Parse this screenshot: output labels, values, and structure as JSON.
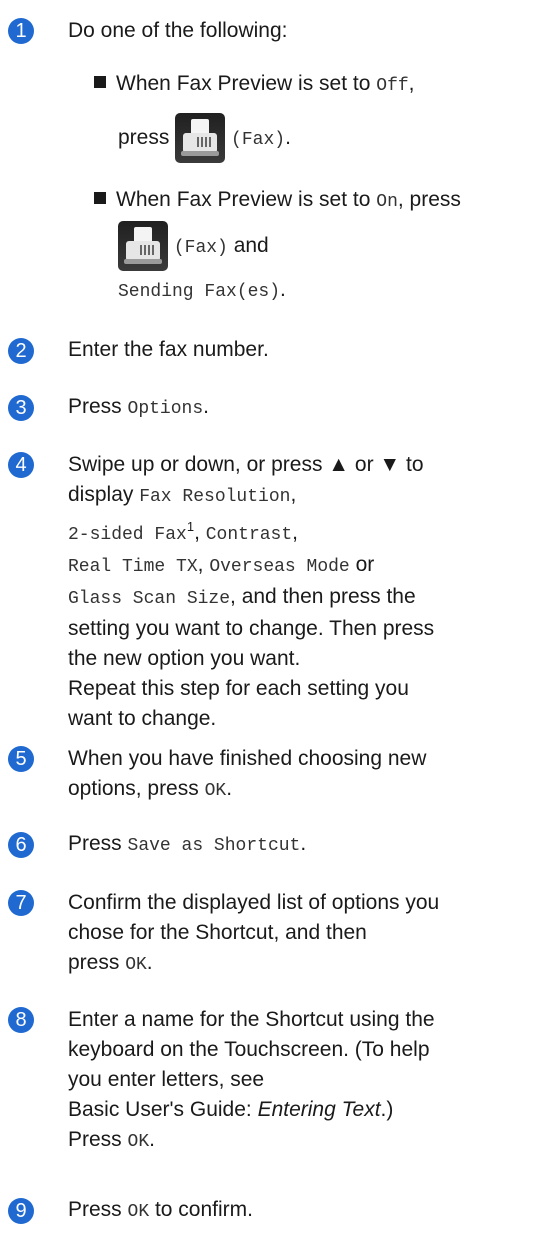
{
  "steps": [
    {
      "number": "1",
      "text": "Do one of the following:"
    },
    {
      "number": "2",
      "text": "Enter the fax number."
    },
    {
      "number": "3",
      "prefix": "Press ",
      "code": "Options",
      "suffix": "."
    },
    {
      "number": "4"
    },
    {
      "number": "5"
    },
    {
      "number": "6",
      "prefix": "Press ",
      "code": "Save as Shortcut",
      "suffix": "."
    },
    {
      "number": "7"
    },
    {
      "number": "8"
    },
    {
      "number": "9",
      "prefix": "Press ",
      "code": "OK",
      "suffix": " to confirm."
    }
  ],
  "bullets": {
    "off": {
      "lead": "When Fax Preview is set to ",
      "mode": "Off",
      "comma": ",",
      "press": "press",
      "label": "(Fax)",
      "period": "."
    },
    "on": {
      "lead": "When Fax Preview is set to ",
      "mode": "On",
      "after_mode": ", press",
      "label": "(Fax)",
      "and": " and",
      "sending": "Sending Fax(es)",
      "period": "."
    }
  },
  "step4": {
    "l1": "Swipe up or down, or press ▲ or ▼ to",
    "l2a": "display ",
    "fax_resolution": "Fax Resolution",
    "comma": ",",
    "two_sided": "2-sided Fax",
    "footnote": "1",
    "contrast": "Contrast",
    "real_time": "Real Time TX",
    "overseas": "Overseas Mode",
    "or": " or",
    "glass": "Glass Scan Size",
    "l4b": ", and then press the",
    "l5": "setting you want to change. Then press",
    "l6": "the new option you want.",
    "l7": "Repeat this step for each setting you",
    "l8": "want to change."
  },
  "step5": {
    "l1": "When you have finished choosing new",
    "l2": "options, press ",
    "code": "OK",
    "period": "."
  },
  "step7": {
    "l1": "Confirm the displayed list of options you",
    "l2": "chose for the Shortcut, and then",
    "l3": "press ",
    "code": "OK",
    "period": "."
  },
  "step8": {
    "l1": "Enter a name for the Shortcut using the",
    "l2": "keyboard on the Touchscreen. (To help",
    "l3": "you enter letters, see",
    "l4a": "Basic User's Guide: ",
    "l4b": "Entering Text",
    "l4c": ".)",
    "l5": "Press ",
    "code": "OK",
    "period": "."
  },
  "icons": {
    "fax": "fax-icon"
  },
  "colors": {
    "step_circle": "#1f69d1",
    "text": "#1a1a1a"
  }
}
